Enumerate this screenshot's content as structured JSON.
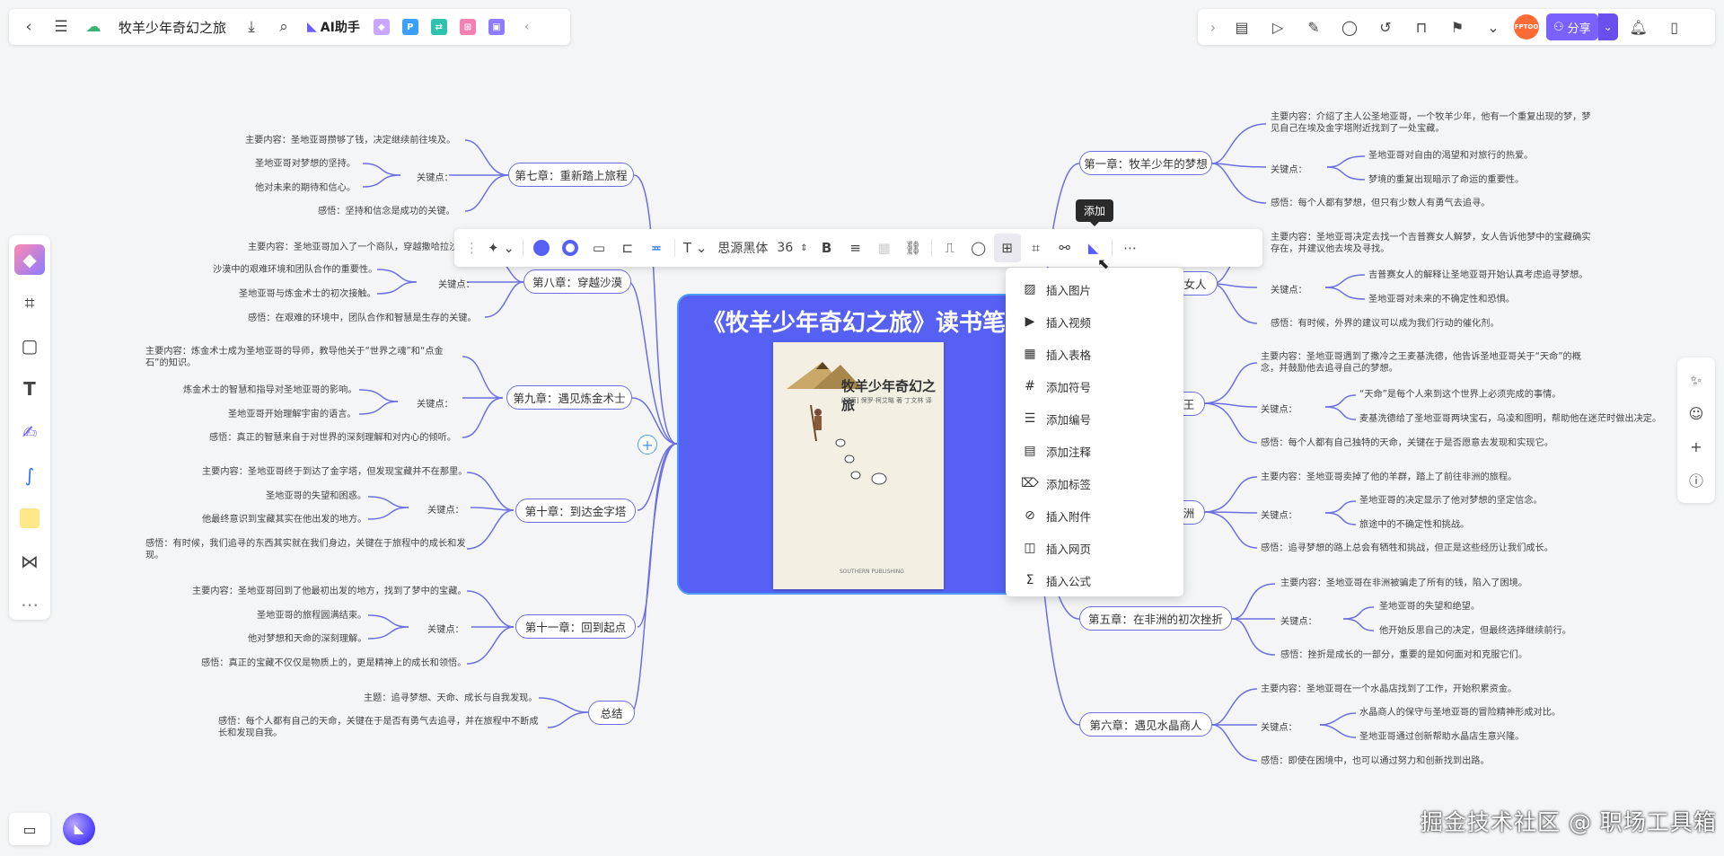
{
  "header": {
    "doc_title": "牧羊少年奇幻之旅",
    "ai_label": "AI助手",
    "share_label": "分享",
    "avatar_text": "FPTOO"
  },
  "central": {
    "title": "《牧羊少年奇幻之旅》读书笔记",
    "cover_title": "牧羊少年奇幻之旅",
    "cover_author": "[巴西] 保罗·柯艾略 著 丁文林 译",
    "cover_publisher": "SOUTHERN PUBLISHING"
  },
  "toolbar": {
    "font_name": "思源黑体",
    "font_size": "36",
    "tooltip": "添加",
    "fill_color": "#5661f4",
    "border_color": "#5661f4"
  },
  "dropdown": {
    "items": [
      {
        "label": "插入图片",
        "icon": "image-icon"
      },
      {
        "label": "插入视频",
        "icon": "video-icon"
      },
      {
        "label": "插入表格",
        "icon": "table-icon"
      },
      {
        "label": "添加符号",
        "icon": "hash-icon"
      },
      {
        "label": "添加编号",
        "icon": "numbered-list-icon"
      },
      {
        "label": "添加注释",
        "icon": "note-icon"
      },
      {
        "label": "添加标签",
        "icon": "tag-icon"
      },
      {
        "label": "插入附件",
        "icon": "paperclip-icon"
      },
      {
        "label": "插入网页",
        "icon": "webpage-icon"
      },
      {
        "label": "插入公式",
        "icon": "formula-icon"
      }
    ]
  },
  "left": {
    "ch7": {
      "title": "第七章：重新踏上旅程",
      "content": "主要内容：圣地亚哥攒够了钱，决定继续前往埃及。",
      "key": "关键点：",
      "k1": "圣地亚哥对梦想的坚持。",
      "k2": "他对未来的期待和信心。",
      "insight": "感悟：坚持和信念是成功的关键。"
    },
    "ch8": {
      "title": "第八章：穿越沙漠",
      "content": "主要内容：圣地亚哥加入了一个商队，穿越撒哈拉沙",
      "key": "关键点：",
      "k1": "沙漠中的艰难环境和团队合作的重要性。",
      "k2": "圣地亚哥与炼金术士的初次接触。",
      "insight": "感悟：在艰难的环境中，团队合作和智慧是生存的关键。"
    },
    "ch9": {
      "title": "第九章：遇见炼金术士",
      "content": "主要内容：炼金术士成为圣地亚哥的导师，教导他关于“世界之魂”和“点金石”的知识。",
      "key": "关键点：",
      "k1": "炼金术士的智慧和指导对圣地亚哥的影响。",
      "k2": "圣地亚哥开始理解宇宙的语言。",
      "insight": "感悟：真正的智慧来自于对世界的深刻理解和对内心的倾听。"
    },
    "ch10": {
      "title": "第十章：到达金字塔",
      "content": "主要内容：圣地亚哥终于到达了金字塔，但发现宝藏并不在那里。",
      "key": "关键点：",
      "k1": "圣地亚哥的失望和困惑。",
      "k2": "他最终意识到宝藏其实在他出发的地方。",
      "insight": "感悟：有时候，我们追寻的东西其实就在我们身边，关键在于旅程中的成长和发现。"
    },
    "ch11": {
      "title": "第十一章：回到起点",
      "content": "主要内容：圣地亚哥回到了他最初出发的地方，找到了梦中的宝藏。",
      "key": "关键点：",
      "k1": "圣地亚哥的旅程圆满结束。",
      "k2": "他对梦想和天命的深刻理解。",
      "insight": "感悟：真正的宝藏不仅仅是物质上的，更是精神上的成长和领悟。"
    },
    "summary": {
      "title": "总结",
      "theme": "主题：追寻梦想、天命、成长与自我发现。",
      "insight": "感悟：每个人都有自己的天命，关键在于是否有勇气去追寻，并在旅程中不断成长和发现自我。"
    }
  },
  "right": {
    "ch1": {
      "title": "第一章：牧羊少年的梦想",
      "content": "主要内容：介绍了主人公圣地亚哥，一个牧羊少年，他有一个重复出现的梦，梦见自己在埃及金字塔附近找到了一处宝藏。",
      "key": "关键点：",
      "k1": "圣地亚哥对自由的渴望和对旅行的热爱。",
      "k2": "梦境的重复出现暗示了命运的重要性。",
      "insight": "感悟：每个人都有梦想，但只有少数人有勇气去追寻。"
    },
    "ch2": {
      "title": "女人",
      "content": "主要内容：圣地亚哥决定去找一个吉普赛女人解梦，女人告诉他梦中的宝藏确实存在，并建议他去埃及寻找。",
      "key": "关键点：",
      "k1": "吉普赛女人的解释让圣地亚哥开始认真考虑追寻梦想。",
      "k2": "圣地亚哥对未来的不确定性和恐惧。",
      "insight": "感悟：有时候，外界的建议可以成为我们行动的催化剂。"
    },
    "ch3": {
      "title": "王",
      "content": "主要内容：圣地亚哥遇到了撒冷之王麦基洗德，他告诉圣地亚哥关于“天命”的概念，并鼓励他去追寻自己的梦想。",
      "key": "关键点：",
      "k1": "“天命”是每个人来到这个世界上必须完成的事情。",
      "k2": "麦基洗德给了圣地亚哥两块宝石，乌凌和图明，帮助他在迷茫时做出决定。",
      "insight": "感悟：每个人都有自己独特的天命，关键在于是否愿意去发现和实现它。"
    },
    "ch4": {
      "title": "洲",
      "content": "主要内容：圣地亚哥卖掉了他的羊群，踏上了前往非洲的旅程。",
      "key": "关键点：",
      "k1": "圣地亚哥的决定显示了他对梦想的坚定信念。",
      "k2": "旅途中的不确定性和挑战。",
      "insight": "感悟：追寻梦想的路上总会有牺牲和挑战，但正是这些经历让我们成长。"
    },
    "ch5": {
      "title": "第五章：在非洲的初次挫折",
      "content": "主要内容：圣地亚哥在非洲被骗走了所有的钱，陷入了困境。",
      "key": "关键点：",
      "k1": "圣地亚哥的失望和绝望。",
      "k2": "他开始反思自己的决定，但最终选择继续前行。",
      "insight": "感悟：挫折是成长的一部分，重要的是如何面对和克服它们。"
    },
    "ch6": {
      "title": "第六章：遇见水晶商人",
      "content": "主要内容：圣地亚哥在一个水晶店找到了工作，开始积累资金。",
      "key": "关键点：",
      "k1": "水晶商人的保守与圣地亚哥的冒险精神形成对比。",
      "k2": "圣地亚哥通过创新帮助水晶店生意兴隆。",
      "insight": "感悟：即使在困境中，也可以通过努力和创新找到出路。"
    }
  },
  "watermark": "掘金技术社区 @ 职场工具箱"
}
